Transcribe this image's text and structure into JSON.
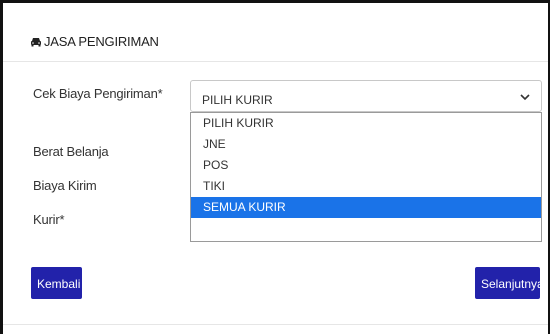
{
  "panel": {
    "title": "JASA PENGIRIMAN",
    "icon": "car-icon"
  },
  "form": {
    "courier_check_label": "Cek Biaya Pengiriman*",
    "weight_label": "Berat Belanja",
    "cost_label": "Biaya Kirim",
    "courier_label": "Kurir*",
    "selected_value": "PILIH KURIR",
    "options": [
      "PILIH KURIR",
      "JNE",
      "POS",
      "TIKI",
      "SEMUA KURIR"
    ],
    "highlighted_option": "SEMUA KURIR"
  },
  "buttons": {
    "back_label": "Kembali",
    "next_label": "Selanjutnya"
  },
  "colors": {
    "button": "#2222aa",
    "highlight": "#1a73e8"
  }
}
